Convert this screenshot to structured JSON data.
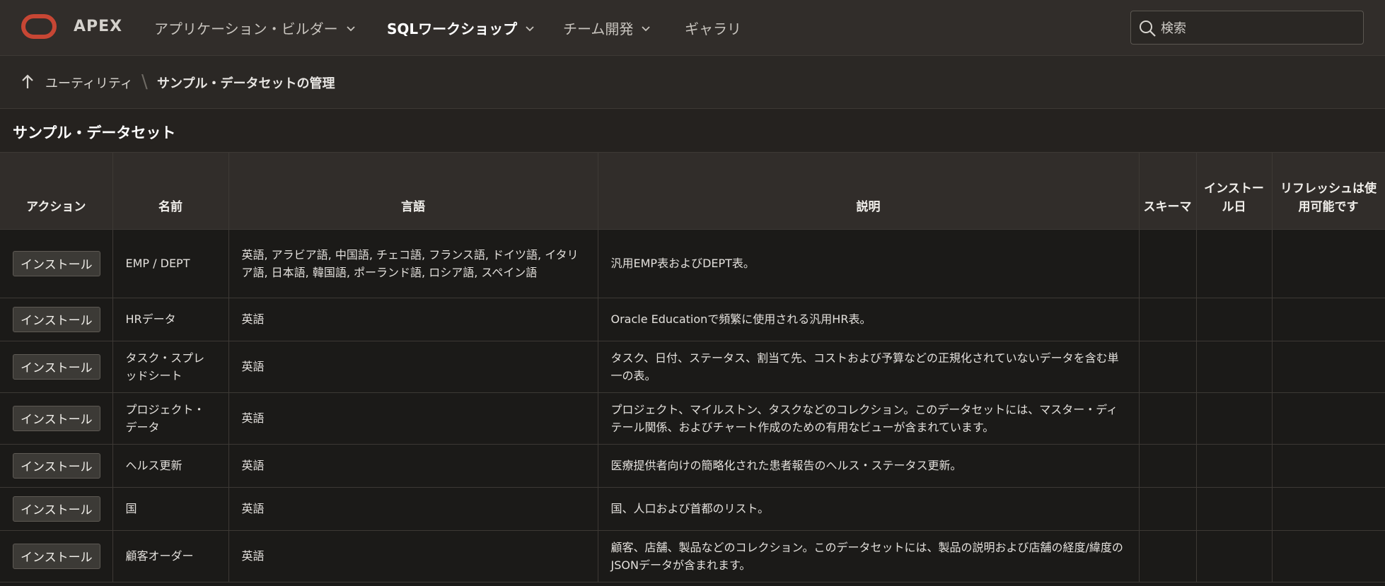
{
  "header": {
    "logo_text": "APEX",
    "nav": [
      {
        "label": "アプリケーション・ビルダー",
        "active": false
      },
      {
        "label": "SQLワークショップ",
        "active": true
      },
      {
        "label": "チーム開発",
        "active": false
      },
      {
        "label": "ギャラリ",
        "active": false
      }
    ],
    "search_placeholder": "検索"
  },
  "breadcrumb": {
    "parent": "ユーティリティ",
    "current": "サンプル・データセットの管理"
  },
  "region": {
    "title": "サンプル・データセット"
  },
  "table": {
    "headers": {
      "action": "アクション",
      "name": "名前",
      "language": "言語",
      "description": "説明",
      "schema": "スキーマ",
      "install_date": "インストール日",
      "refresh": "リフレッシュは使用可能です"
    },
    "install_label": "インストール",
    "rows": [
      {
        "name": "EMP / DEPT",
        "language": "英語, アラビア語, 中国語, チェコ語, フランス語, ドイツ語, イタリア語, 日本語, 韓国語, ポーランド語, ロシア語, スペイン語",
        "description": "汎用EMP表およびDEPT表。",
        "schema": "",
        "install_date": "",
        "refresh": ""
      },
      {
        "name": "HRデータ",
        "language": "英語",
        "description": "Oracle Educationで頻繁に使用される汎用HR表。",
        "schema": "",
        "install_date": "",
        "refresh": ""
      },
      {
        "name": "タスク・スプレッドシート",
        "language": "英語",
        "description": "タスク、日付、ステータス、割当て先、コストおよび予算などの正規化されていないデータを含む単一の表。",
        "schema": "",
        "install_date": "",
        "refresh": ""
      },
      {
        "name": "プロジェクト・データ",
        "language": "英語",
        "description": "プロジェクト、マイルストン、タスクなどのコレクション。このデータセットには、マスター・ディテール関係、およびチャート作成のための有用なビューが含まれています。",
        "schema": "",
        "install_date": "",
        "refresh": ""
      },
      {
        "name": "ヘルス更新",
        "language": "英語",
        "description": "医療提供者向けの簡略化された患者報告のヘルス・ステータス更新。",
        "schema": "",
        "install_date": "",
        "refresh": ""
      },
      {
        "name": "国",
        "language": "英語",
        "description": "国、人口および首都のリスト。",
        "schema": "",
        "install_date": "",
        "refresh": ""
      },
      {
        "name": "顧客オーダー",
        "language": "英語",
        "description": "顧客、店舗、製品などのコレクション。このデータセットには、製品の説明および店舗の経度/緯度のJSONデータが含まれます。",
        "schema": "",
        "install_date": "",
        "refresh": ""
      }
    ]
  }
}
